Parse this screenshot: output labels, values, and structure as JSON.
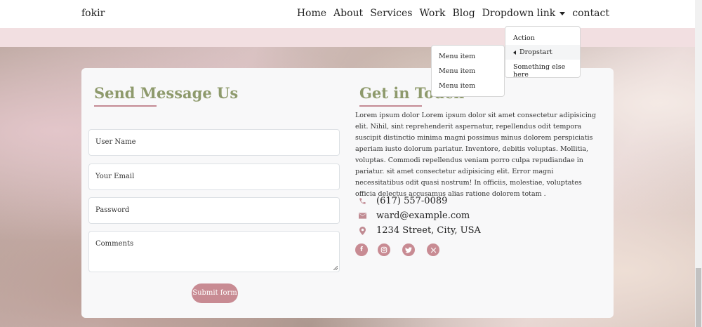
{
  "navbar": {
    "brand": "fokir",
    "links": [
      "Home",
      "About",
      "Services",
      "Work",
      "Blog",
      "Dropdown link",
      "contact"
    ]
  },
  "dropdown": {
    "items": [
      "Action",
      "Dropstart",
      "Something else here"
    ],
    "submenu": [
      "Menu item",
      "Menu item",
      "Menu item"
    ]
  },
  "form": {
    "title": "Send Message Us",
    "placeholders": [
      "User Name",
      "Your Email",
      "Password",
      "Comments"
    ],
    "submit_label": "Submit form"
  },
  "contact": {
    "title": "Get in Touch",
    "body": "Lorem ipsum dolor Lorem ipsum dolor sit amet consectetur adipisicing elit. Nihil, sint reprehenderit aspernatur, repellendus odit tempora suscipit distinctio minima magni possimus minus dolorem perspiciatis aperiam iusto dolorum pariatur. Inventore, debitis voluptas. Mollitia, voluptas. Commodi repellendus veniam porro culpa repudiandae in pariatur. sit amet consectetur adipisicing elit. Error magni necessitatibus odit quasi nostrum! In officiis, molestiae, voluptates officia delectus accusamus alias ratione dolorem totam .",
    "phone": "(617) 557-0089",
    "email": "ward@example.com",
    "address": "1234 Street, City, USA",
    "icons": [
      "phone-icon",
      "envelope-icon",
      "location-pin-icon"
    ],
    "social_icons": [
      "facebook-icon",
      "instagram-icon",
      "twitter-icon",
      "x-icon"
    ]
  },
  "colors": {
    "accent_green": "#8e9a6c",
    "accent_pink": "#c88b93",
    "band_pink": "#f2dfe1"
  }
}
